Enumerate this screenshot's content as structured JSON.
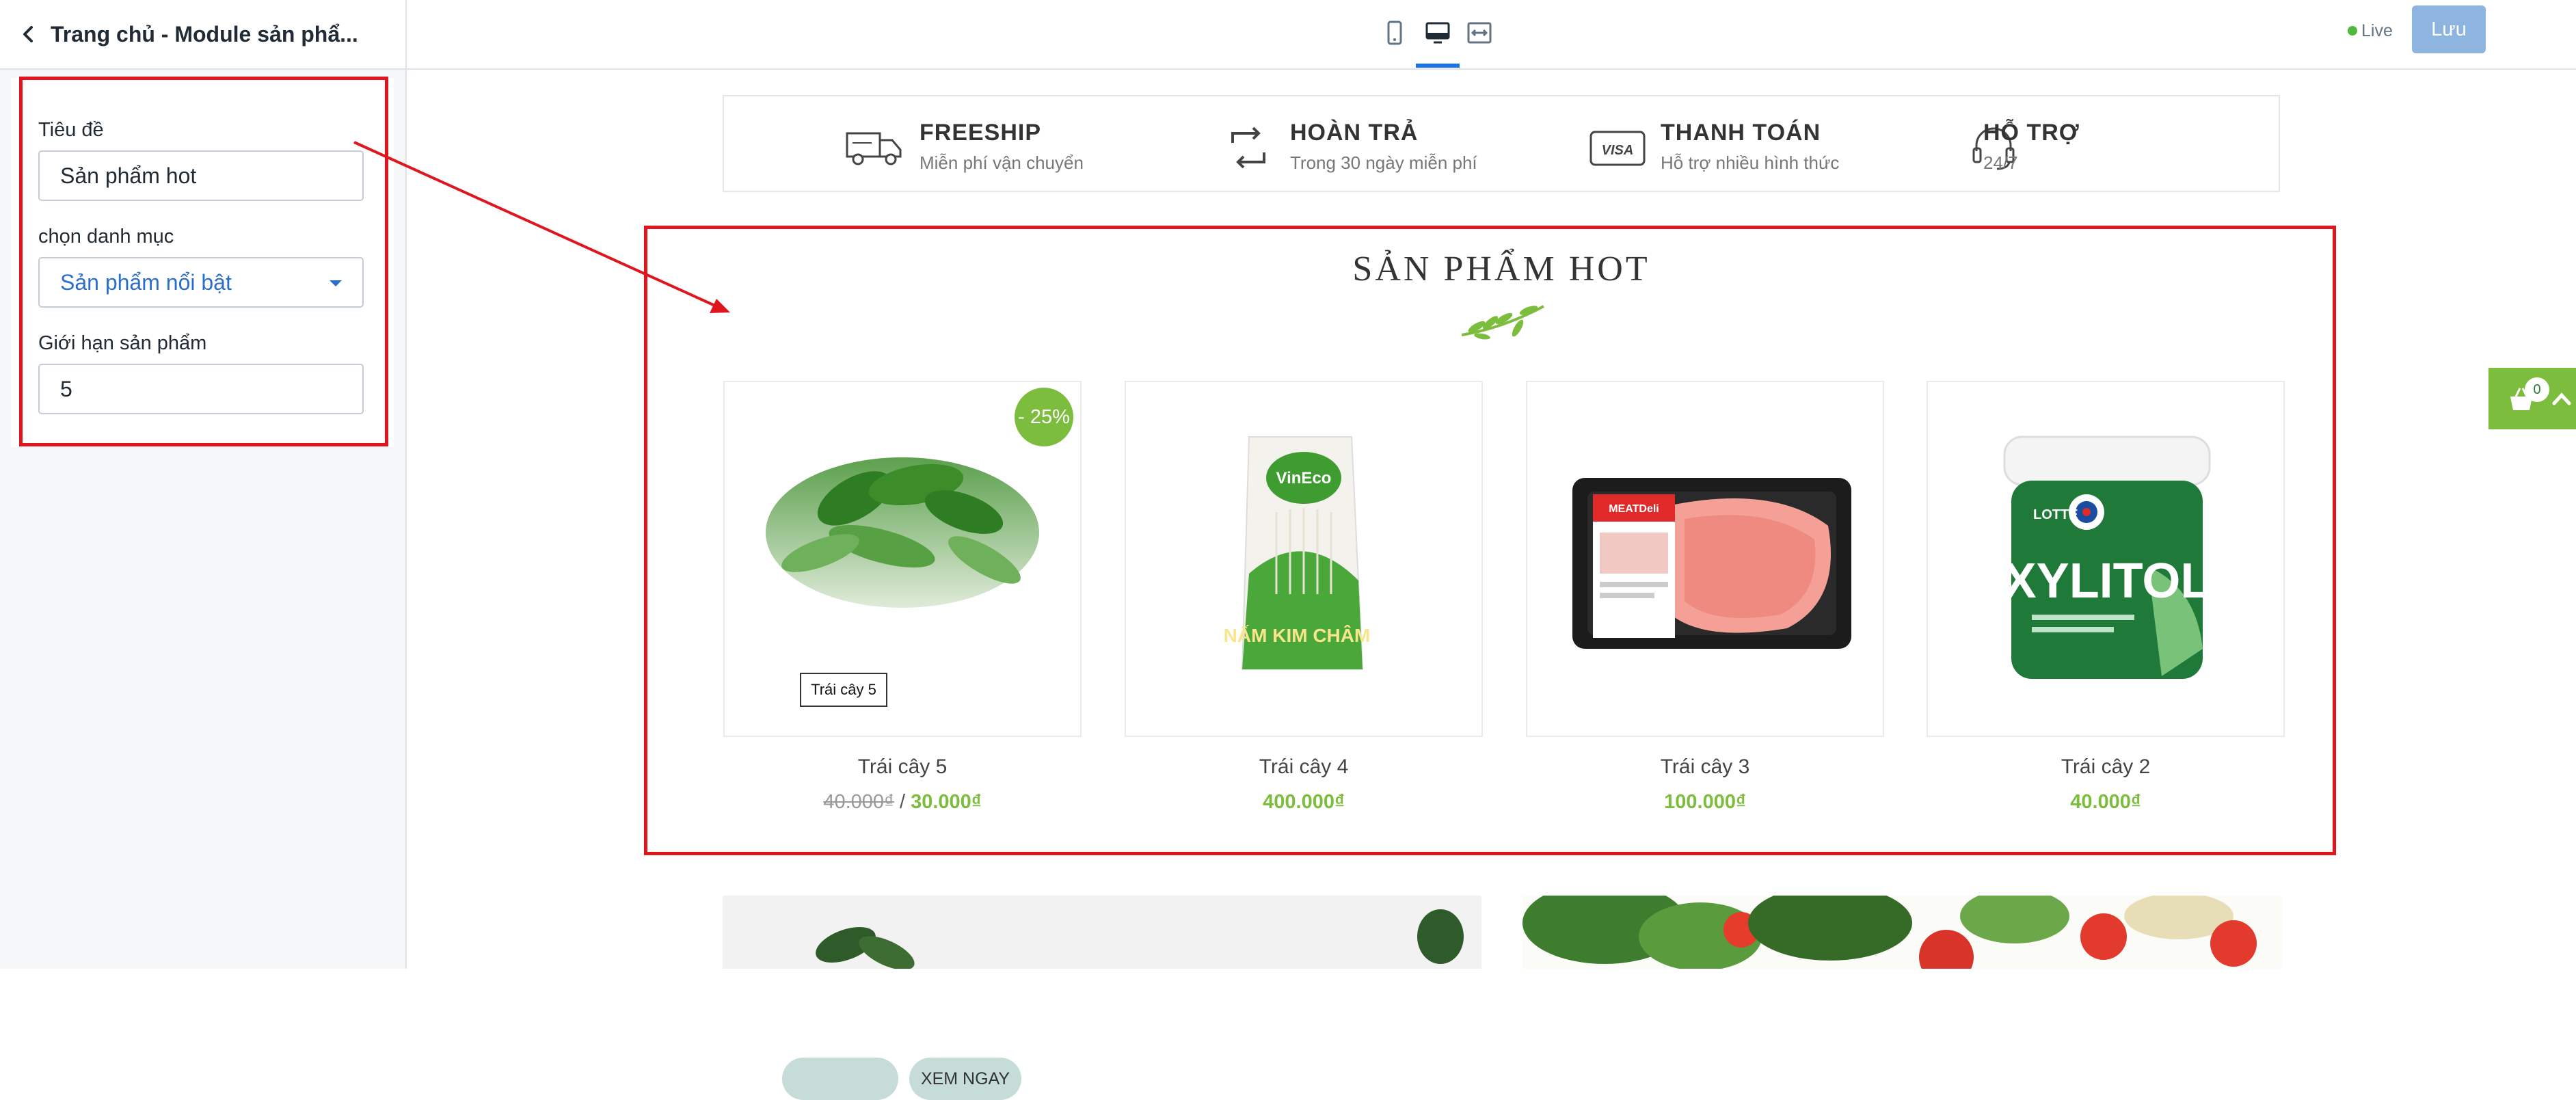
{
  "sidebar": {
    "title": "Trang chủ - Module sản phẩ...",
    "fields": {
      "title_label": "Tiêu đề",
      "title_value": "Sản phẩm hot",
      "category_label": "chọn danh mục",
      "category_value": "Sản phẩm nổi bật",
      "limit_label": "Giới hạn sản phẩm",
      "limit_value": "5"
    }
  },
  "topbar": {
    "device_icons": [
      "mobile-icon",
      "desktop-icon",
      "fullwidth-icon"
    ],
    "active_device": "desktop",
    "live_label": "Live",
    "save_label": "Lưu"
  },
  "policies": [
    {
      "icon": "truck-icon",
      "title": "FREESHIP",
      "subtitle": "Miễn phí vận chuyển"
    },
    {
      "icon": "return-icon",
      "title": "HOÀN TRẢ",
      "subtitle": "Trong 30 ngày miễn phí"
    },
    {
      "icon": "visa-card-icon",
      "title": "THANH TOÁN",
      "subtitle": "Hỗ trợ nhiều hình thức",
      "card_text": "VISA"
    },
    {
      "icon": "headset-icon",
      "title": "HỖ TRỢ",
      "subtitle": "24/7"
    }
  ],
  "section": {
    "title": "SẢN PHẨM HOT"
  },
  "products": [
    {
      "name": "Trái cây 5",
      "old_price": "40.000₫",
      "price": "30.000₫",
      "discount": "- 25%",
      "image": "greens-image",
      "hover_action": "XEM NGAY",
      "tooltip": "Trái cây 5"
    },
    {
      "name": "Trái cây 4",
      "price": "400.000₫",
      "image": "enoki-mushroom-pack-image",
      "pack_text": "NẤM KIM CHÂM",
      "brand": "VinEco"
    },
    {
      "name": "Trái cây 3",
      "price": "100.000₫",
      "image": "meat-tray-image",
      "brand": "MEATDeli"
    },
    {
      "name": "Trái cây 2",
      "price": "40.000₫",
      "image": "xylitol-jar-image",
      "brand": "LOTTE",
      "jar_text": "XYLITOL"
    }
  ],
  "cart": {
    "count": "0"
  },
  "colors": {
    "accent_green": "#7cbd3d",
    "annotation_red": "#e0161e",
    "save_button": "#8eb5e0",
    "select_text": "#2c6ecb"
  }
}
